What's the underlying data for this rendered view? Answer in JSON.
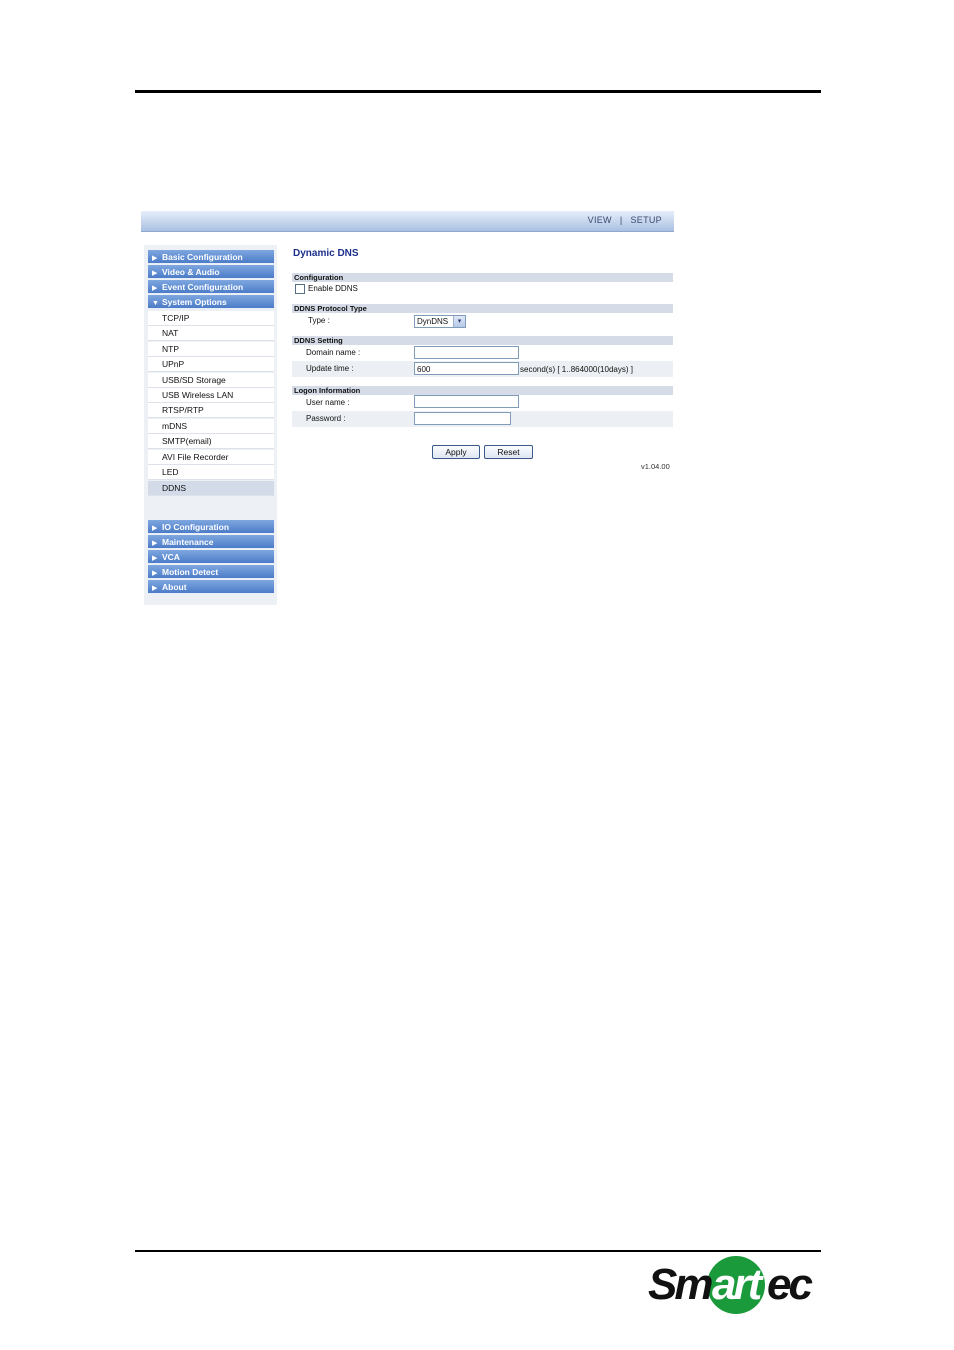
{
  "header": {
    "view_label": "VIEW",
    "separator": "|",
    "setup_label": "SETUP"
  },
  "sidebar": {
    "top_menus": [
      {
        "label": "Basic Configuration",
        "arrow": "▶"
      },
      {
        "label": "Video & Audio",
        "arrow": "▶"
      },
      {
        "label": "Event Configuration",
        "arrow": "▶"
      },
      {
        "label": "System Options",
        "arrow": "▼"
      }
    ],
    "system_options": [
      "TCP/IP",
      "NAT",
      "NTP",
      "UPnP",
      "USB/SD Storage",
      "USB Wireless LAN",
      "RTSP/RTP",
      "mDNS",
      "SMTP(email)",
      "AVI File Recorder",
      "LED",
      "DDNS"
    ],
    "active_item": "DDNS",
    "bottom_menus": [
      {
        "label": "IO Configuration",
        "arrow": "▶"
      },
      {
        "label": "Maintenance",
        "arrow": "▶"
      },
      {
        "label": "VCA",
        "arrow": "▶"
      },
      {
        "label": "Motion Detect",
        "arrow": "▶"
      },
      {
        "label": "About",
        "arrow": "▶"
      }
    ]
  },
  "main": {
    "title": "Dynamic DNS",
    "configuration": {
      "header": "Configuration",
      "enable_label": "Enable DDNS",
      "enabled": false
    },
    "protocol": {
      "header": "DDNS Protocol Type",
      "type_label": "Type :",
      "type_value": "DynDNS"
    },
    "setting": {
      "header": "DDNS Setting",
      "domain_label": "Domain name :",
      "domain_value": "",
      "update_label": "Update time :",
      "update_value": "600",
      "update_hint": "second(s) [ 1..864000(10days) ]"
    },
    "logon": {
      "header": "Logon Information",
      "user_label": "User name :",
      "user_value": "",
      "password_label": "Password :",
      "password_value": ""
    },
    "apply_label": "Apply",
    "reset_label": "Reset",
    "version": "v1.04.00"
  },
  "footer": {
    "logo_text": "Smartec",
    "logo_color": "#1a9a3a"
  },
  "colors": {
    "menu_head": "#4c7cc8",
    "title": "#1c2f8a",
    "section_bg": "#d5dce8"
  }
}
